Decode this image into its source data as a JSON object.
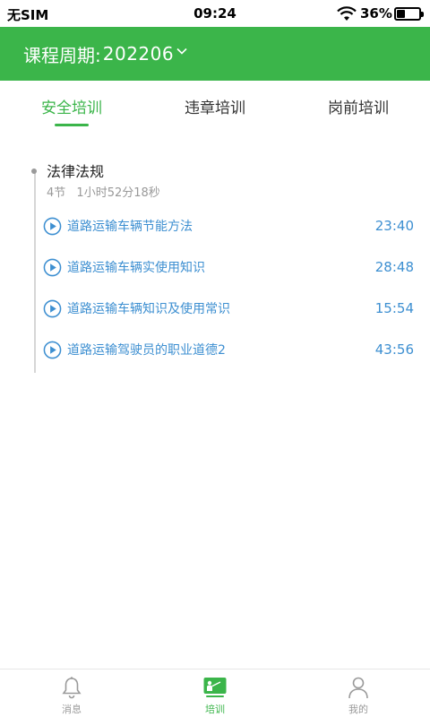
{
  "status_bar": {
    "carrier": "无SIM",
    "time": "09:24",
    "battery_percent": "36%",
    "battery_level": 0.36
  },
  "header": {
    "period_label": "课程周期:",
    "period_value": "202206"
  },
  "tabs": [
    {
      "label": "安全培训",
      "active": true
    },
    {
      "label": "违章培训",
      "active": false
    },
    {
      "label": "岗前培训",
      "active": false
    }
  ],
  "section": {
    "title": "法律法规",
    "lesson_count": "4节",
    "total_duration": "1小时52分18秒"
  },
  "lessons": [
    {
      "title": "道路运输车辆节能方法",
      "duration": "23:40"
    },
    {
      "title": "道路运输车辆实使用知识",
      "duration": "28:48"
    },
    {
      "title": "道路运输车辆知识及使用常识",
      "duration": "15:54"
    },
    {
      "title": "道路运输驾驶员的职业道德2",
      "duration": "43:56"
    }
  ],
  "bottom_nav": [
    {
      "label": "消息",
      "icon": "bell-icon",
      "active": false
    },
    {
      "label": "培训",
      "icon": "training-icon",
      "active": true
    },
    {
      "label": "我的",
      "icon": "person-icon",
      "active": false
    }
  ],
  "colors": {
    "brand_green": "#3bb54a",
    "link_blue": "#3d8fd1",
    "muted_gray": "#999999"
  }
}
